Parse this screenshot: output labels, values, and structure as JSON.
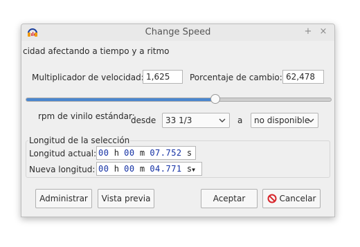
{
  "window": {
    "title": "Change Speed",
    "minimize_glyph": "+",
    "close_glyph": "×",
    "subtitle": "cidad afectando a tiempo y a ritmo"
  },
  "speed": {
    "multiplier_label": "Multiplicador de velocidad:",
    "multiplier_value": "1,625",
    "percent_label": "Porcentaje de cambio:",
    "percent_value": "62,478",
    "slider_level": 0.62
  },
  "vinyl": {
    "label": "rpm de vinilo estándar:",
    "from_label": "desde",
    "from_value": "33 1/3",
    "to_label": "a",
    "to_value": "no disponible"
  },
  "selection": {
    "group_title": "Longitud de la selección",
    "current_label": "Longitud actual:",
    "current": {
      "h": "00",
      "m": "00",
      "s": "07.752"
    },
    "new_label": "Nueva longitud:",
    "new": {
      "h": "00",
      "m": "00",
      "s": "04.771"
    },
    "unit_h": "h",
    "unit_m": "m",
    "unit_s": "s"
  },
  "buttons": {
    "manage": "Administrar",
    "preview": "Vista previa",
    "ok": "Aceptar",
    "cancel": "Cancelar"
  },
  "colors": {
    "accent": "#4a86cf",
    "digits": "#1330a4",
    "cancel_icon": "#d7262b"
  }
}
